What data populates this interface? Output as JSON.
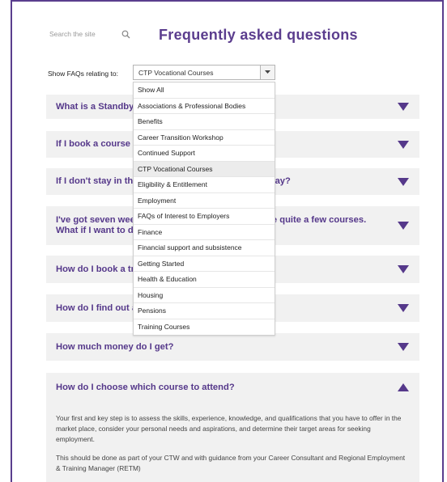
{
  "search": {
    "placeholder": "Search the site",
    "icon": "search-icon"
  },
  "page_title": "Frequently asked questions",
  "filter": {
    "label": "Show FAQs relating to:",
    "selected": "CTP Vocational Courses",
    "options": [
      "Show All",
      "Associations & Professional Bodies",
      "Benefits",
      "Career Transition Workshop",
      "Continued Support",
      "CTP Vocational Courses",
      "Eligibility & Entitlement",
      "Employment",
      "FAQs of Interest to Employers",
      "Finance",
      "Financial support and subsistence",
      "Getting Started",
      "Health & Education",
      "Housing",
      "Pensions",
      "Training Courses"
    ]
  },
  "faqs": [
    {
      "question": "What is a Standby Course?",
      "expanded": false
    },
    {
      "question": "If I book a course do I get accommodation?",
      "expanded": false
    },
    {
      "question": "If I don't stay in the accommodation, where can I stay?",
      "expanded": false
    },
    {
      "question": "I've got seven weeks to do my course and there are quite a few courses. What if I want to do my",
      "expanded": false
    },
    {
      "question": "How do I book a training course?",
      "expanded": false
    },
    {
      "question": "How do I find out about courses?",
      "expanded": false
    },
    {
      "question": "How much money do I get?",
      "expanded": false
    },
    {
      "question": "How do I choose which course to attend?",
      "expanded": true
    }
  ],
  "answer": {
    "p1": "Your first and key step is to assess the skills, experience, knowledge, and qualifications that you have to offer in the market place, consider your personal needs and aspirations, and determine their target areas for seeking employment.",
    "p2": "This should be done as part of your CTW and with guidance from your Career Consultant and Regional Employment & Training Manager (RETM)"
  },
  "colors": {
    "accent": "#55388a",
    "panel": "#f1f1f1",
    "frame": "#5a3e8e"
  }
}
